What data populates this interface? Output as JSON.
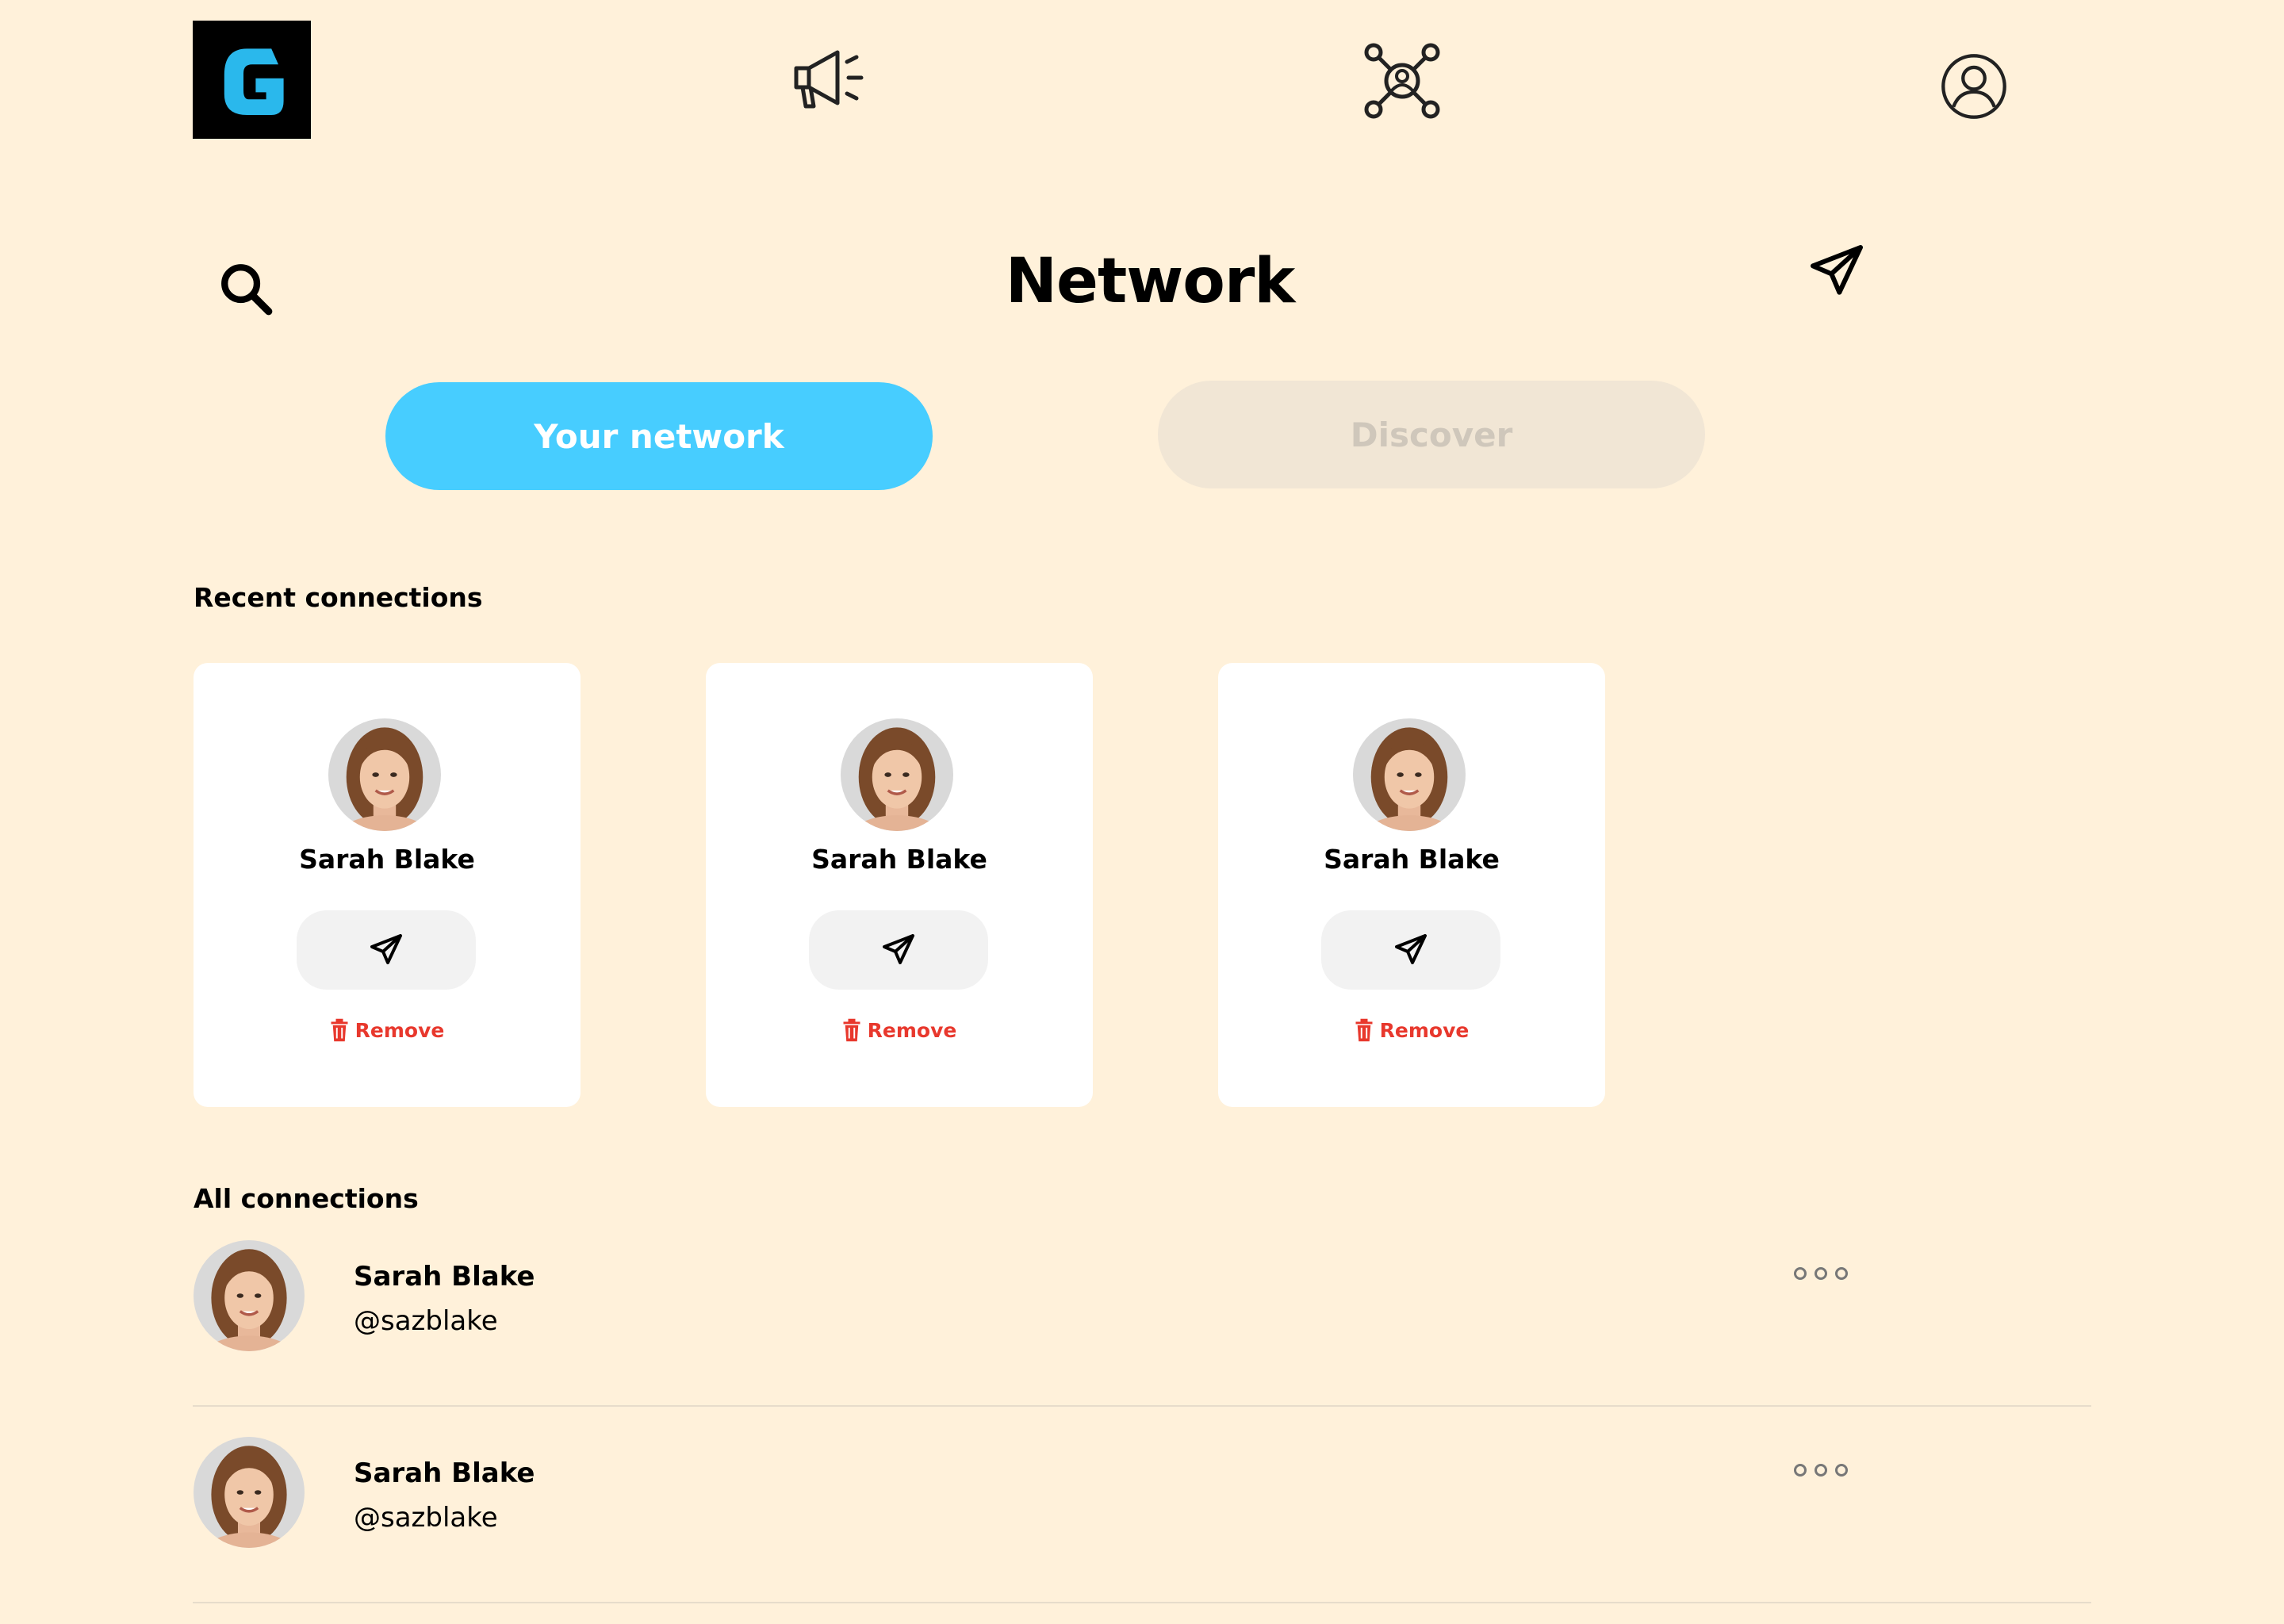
{
  "nav": {
    "logo_letter": "G",
    "items": [
      {
        "icon": "megaphone-icon"
      },
      {
        "icon": "network-icon"
      },
      {
        "icon": "profile-icon"
      }
    ]
  },
  "header": {
    "title": "Network",
    "search_icon": "search-icon",
    "messages_icon": "paper-plane-icon"
  },
  "tabs": {
    "active": "Your network",
    "inactive": "Discover"
  },
  "recent": {
    "title": "Recent connections",
    "cards": [
      {
        "name": "Sarah Blake",
        "remove_label": "Remove"
      },
      {
        "name": "Sarah Blake",
        "remove_label": "Remove"
      },
      {
        "name": "Sarah Blake",
        "remove_label": "Remove"
      }
    ]
  },
  "all": {
    "title": "All connections",
    "rows": [
      {
        "name": "Sarah Blake",
        "handle": "@sazblake"
      },
      {
        "name": "Sarah Blake",
        "handle": "@sazblake"
      }
    ]
  },
  "colors": {
    "background": "#fff1da",
    "accent": "#47cdff",
    "danger": "#e8382d"
  }
}
